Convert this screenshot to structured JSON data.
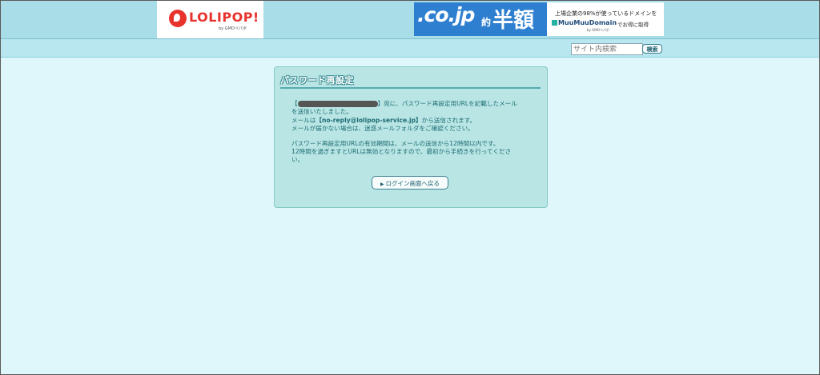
{
  "header": {
    "logo_text": "LOLIPOP!",
    "logo_sub": "by GMOペパボ",
    "banner": {
      "cojp": ".co.jp",
      "yaku": "約",
      "hangaku": "半額",
      "line1": "上場企業の98%が使っているドメインを",
      "brand": "MuuMuuDomain",
      "cta": "でお得に取得",
      "sub": "by GMOペパボ"
    }
  },
  "search": {
    "placeholder": "サイト内検索",
    "button_label": "検索"
  },
  "card": {
    "title": "パスワード再設定",
    "line1_open": "【",
    "line1_rest": "】宛に、パスワード再設定用URLを記載したメール",
    "line2": "を送信いたしました。",
    "line3_prefix": "メールは",
    "line3_email": "【no-reply@lolipop-service.jp】",
    "line3_suffix": "から送信されます。",
    "line4": "メールが届かない場合は、迷惑メールフォルダをご確認ください。",
    "line5": "パスワード再設定用URLの有効期間は、メールの送信から12時間以内です。",
    "line6": "12時間を過ぎますとURLは無効となりますので、最初から手続きを行ってくださ",
    "line7": "い。",
    "back_button": "ログイン画面へ戻る"
  },
  "colors": {
    "page_bg": "#dff7fb",
    "header_bg": "#a9dde8",
    "card_bg": "#b9e6e4",
    "text": "#1d6b74",
    "logo_red": "#e8332d",
    "banner_blue": "#2e7fd0"
  }
}
